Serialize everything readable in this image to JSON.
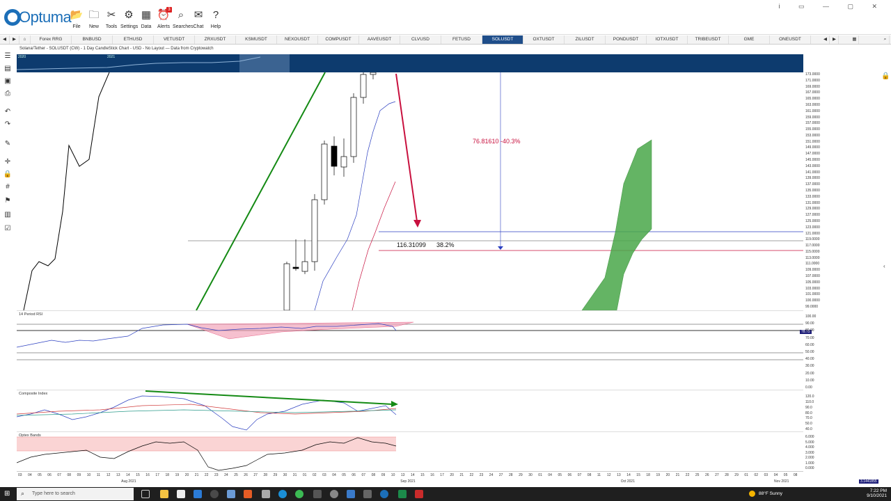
{
  "app": {
    "name": "Optuma"
  },
  "ribbon": {
    "buttons": [
      {
        "label": "File",
        "icon": "folder-icon"
      },
      {
        "label": "New",
        "icon": "new-folder-icon"
      },
      {
        "label": "Tools",
        "icon": "tools-icon"
      },
      {
        "label": "Settings",
        "icon": "gear-icon"
      },
      {
        "label": "Data",
        "icon": "data-icon"
      },
      {
        "label": "Alerts",
        "icon": "alarm-icon",
        "badge": "3"
      },
      {
        "label": "Searches",
        "icon": "search-icon"
      },
      {
        "label": "Chat",
        "icon": "chat-icon"
      },
      {
        "label": "Help",
        "icon": "help-icon"
      }
    ]
  },
  "tabs": [
    "Forex RRG",
    "BNBUSD",
    "ETHUSD",
    "VETUSDT",
    "ZRXUSDT",
    "KSMUSDT",
    "NEXOUSDT",
    "COMPUSDT",
    "AAVEUSDT",
    "CLVUSD",
    "FETUSD",
    "SOLUSDT",
    "OXTUSDT",
    "ZILUSDT",
    "PONDUSDT",
    "IOTXUSDT",
    "TRIBEUSDT",
    "GME",
    "ONEUSDT"
  ],
  "active_tab": "SOLUSDT",
  "chart": {
    "subtitle": "Solana/Tether - SOLUSDT (CW) - 1 Day CandleStick Chart - USD - No Layout — Data from Cryptowatch",
    "overview_years": [
      "2020",
      "2021"
    ],
    "annotations": {
      "drop": "76.81610  -40.3%",
      "retrace_value": "116.31099",
      "retrace_pct": "38.2%"
    },
    "price_axis": [
      "173.0000",
      "171.0000",
      "169.0000",
      "167.0000",
      "165.0000",
      "163.0000",
      "161.0000",
      "159.0000",
      "157.0000",
      "155.0000",
      "153.0000",
      "151.0000",
      "149.0000",
      "147.0000",
      "145.0000",
      "143.0000",
      "141.0000",
      "139.0000",
      "137.0000",
      "135.0000",
      "133.0000",
      "131.0000",
      "129.0000",
      "127.0000",
      "125.0000",
      "123.0000",
      "121.0000",
      "119.0000",
      "117.0000",
      "115.0000",
      "113.0000",
      "111.0000",
      "109.0000",
      "107.0000",
      "105.0000",
      "103.0000",
      "101.0000",
      "100.0000",
      "99.0000"
    ],
    "rsi": {
      "title": "14 Period RSI",
      "axis": [
        "100.00",
        "90.00",
        "80.00",
        "70.00",
        "60.00",
        "50.00",
        "40.00",
        "30.00",
        "20.00",
        "10.00",
        "0.00"
      ],
      "current": "78.75"
    },
    "composite": {
      "title": "Composite Index",
      "axis": [
        "120.0",
        "110.0",
        "90.0",
        "80.0",
        "70.0",
        "50.0",
        "40.0"
      ]
    },
    "optex": {
      "title": "Optex Bands",
      "axis": [
        "6.000",
        "5.000",
        "4.000",
        "3.000",
        "2.000",
        "1.000",
        "0.000"
      ],
      "current": "3.1441855"
    },
    "date_ticks": [
      "03",
      "04",
      "05",
      "06",
      "07",
      "08",
      "09",
      "10",
      "11",
      "12",
      "13",
      "14",
      "15",
      "16",
      "17",
      "18",
      "19",
      "20",
      "21",
      "22",
      "23",
      "24",
      "25",
      "26",
      "27",
      "28",
      "29",
      "30",
      "31",
      "01",
      "02",
      "03",
      "04",
      "05",
      "06",
      "07",
      "08",
      "09",
      "10",
      "13",
      "14",
      "15",
      "16",
      "17",
      "20",
      "21",
      "22",
      "23",
      "24",
      "27",
      "28",
      "29",
      "30",
      "01",
      "04",
      "05",
      "06",
      "07",
      "08",
      "11",
      "12",
      "13",
      "14",
      "15",
      "18",
      "19",
      "20",
      "21",
      "22",
      "25",
      "26",
      "27",
      "28",
      "29",
      "01",
      "02",
      "03",
      "04",
      "05",
      "08"
    ],
    "months": [
      {
        "label": "Aug 2021"
      },
      {
        "label": "Sep 2021"
      },
      {
        "label": "Oct 2021"
      },
      {
        "label": "Nov 2021"
      }
    ]
  },
  "taskbar": {
    "search_placeholder": "Type here to search",
    "weather": "88°F  Sunny",
    "time": "7:22 PM",
    "date": "9/10/2021"
  },
  "colors": {
    "accent": "#1f4e8a",
    "bear": "#c8103e",
    "bull": "#148a14"
  }
}
